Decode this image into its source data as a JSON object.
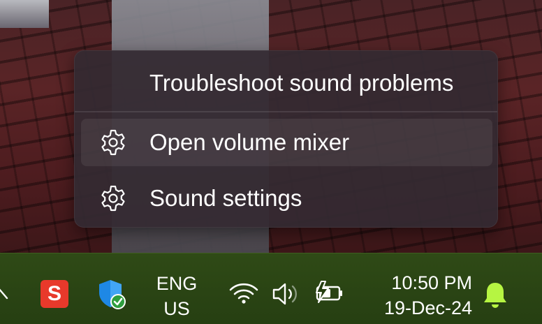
{
  "context_menu": {
    "items": [
      {
        "label": "Troubleshoot sound problems",
        "icon": "none"
      },
      {
        "label": "Open volume mixer",
        "icon": "gear-icon",
        "hovered": true
      },
      {
        "label": "Sound settings",
        "icon": "gear-icon"
      }
    ]
  },
  "taskbar": {
    "language": {
      "line1": "ENG",
      "line2": "US"
    },
    "clock": {
      "time": "10:50 PM",
      "date": "19-Dec-24"
    },
    "app_s_label": "S",
    "tray_icons": [
      "wifi-icon",
      "volume-icon",
      "battery-charging-icon",
      "notification-bell-icon"
    ],
    "colors": {
      "background": "#2a4414",
      "bell": "#b6f542",
      "app_s": "#e8392b",
      "defender": "#1e88e5",
      "check": "#2e9e3e"
    }
  }
}
